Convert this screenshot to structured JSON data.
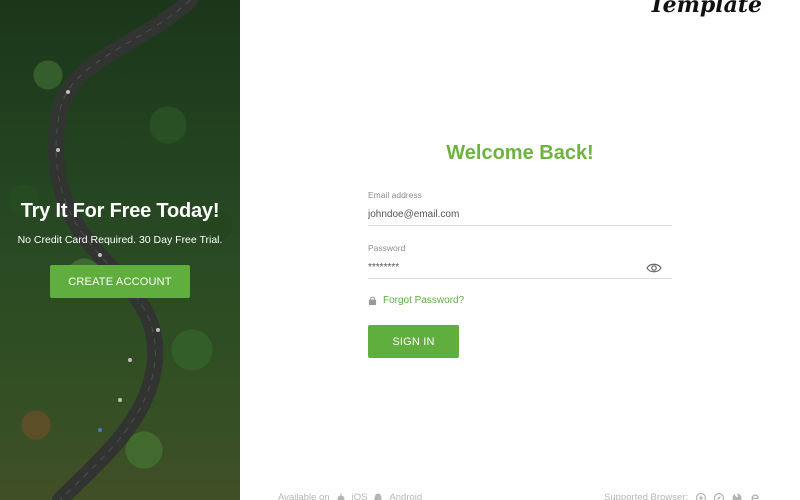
{
  "brand": {
    "logo_text": "Template"
  },
  "hero": {
    "title": "Try It For Free Today!",
    "subtitle": "No Credit Card Required. 30 Day Free Trial.",
    "cta_label": "CREATE ACCOUNT"
  },
  "login": {
    "heading": "Welcome Back!",
    "email_label": "Email address",
    "email_value": "johndoe@email.com",
    "password_label": "Password",
    "password_value": "********",
    "forgot_label": "Forgot Password?",
    "submit_label": "SIGN IN"
  },
  "footer": {
    "available_label": "Available on",
    "platforms": [
      "iOS",
      "Android"
    ],
    "browsers_label": "Supported Browser:"
  },
  "colors": {
    "accent": "#5fae3e",
    "heading": "#6db33f"
  },
  "icons": [
    "apple-icon",
    "android-icon",
    "eye-icon",
    "lock-icon",
    "browser-icon"
  ]
}
